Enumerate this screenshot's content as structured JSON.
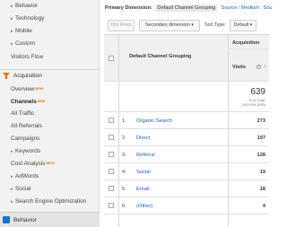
{
  "sidebar": {
    "items": [
      {
        "label": "Behavior",
        "arrow": "▸"
      },
      {
        "label": "Technology",
        "arrow": "▸"
      },
      {
        "label": "Mobile",
        "arrow": "▸"
      },
      {
        "label": "Custom",
        "arrow": "▸"
      },
      {
        "label": "Visitors Flow",
        "arrow": ""
      }
    ],
    "section_title": "Acquisition",
    "acq_items": [
      {
        "label": "Overview",
        "badge": "NEW",
        "arrow": ""
      },
      {
        "label": "Channels",
        "badge": "NEW",
        "arrow": "",
        "active": true
      },
      {
        "label": "All Traffic",
        "badge": "",
        "arrow": ""
      },
      {
        "label": "All Referrals",
        "badge": "",
        "arrow": ""
      },
      {
        "label": "Campaigns",
        "badge": "",
        "arrow": ""
      },
      {
        "label": "Keywords",
        "badge": "",
        "arrow": "▸"
      },
      {
        "label": "Cost Analysis",
        "badge": "BETA",
        "arrow": ""
      },
      {
        "label": "AdWords",
        "badge": "",
        "arrow": "▸"
      },
      {
        "label": "Social",
        "badge": "",
        "arrow": "▸"
      },
      {
        "label": "Search Engine Optimization",
        "badge": "",
        "arrow": "▸"
      }
    ],
    "footer_label": "Behavior"
  },
  "dimension_bar": {
    "label": "Primary Dimension:",
    "active": "Default Channel Grouping",
    "link1": "Source / Medium",
    "link2": "Sou"
  },
  "controls": {
    "plot_rows": "Plot Rows",
    "secondary_dimension": "Secondary dimension ▾",
    "sort_type_label": "Sort Type:",
    "sort_type_value": "Default ▾"
  },
  "table": {
    "group_header": "Acquisition",
    "dimension_header": "Default Channel Grouping",
    "metric_header": "Visits",
    "sort_arrow": "↓",
    "help": "?",
    "total": "639",
    "total_sub1": "% of Total:",
    "total_sub2": "100.00% (639)",
    "rows": [
      {
        "num": "1.",
        "name": "Organic Search",
        "value": "273"
      },
      {
        "num": "2.",
        "name": "Direct",
        "value": "197"
      },
      {
        "num": "3.",
        "name": "Referral",
        "value": "128"
      },
      {
        "num": "4.",
        "name": "Social",
        "value": "19"
      },
      {
        "num": "5.",
        "name": "Email",
        "value": "18"
      },
      {
        "num": "6.",
        "name": "(Other)",
        "value": "4"
      }
    ]
  },
  "colors": {
    "link": "#1a5fb4",
    "badge": "#e8710a",
    "footer_icon": "#1a74c4"
  }
}
